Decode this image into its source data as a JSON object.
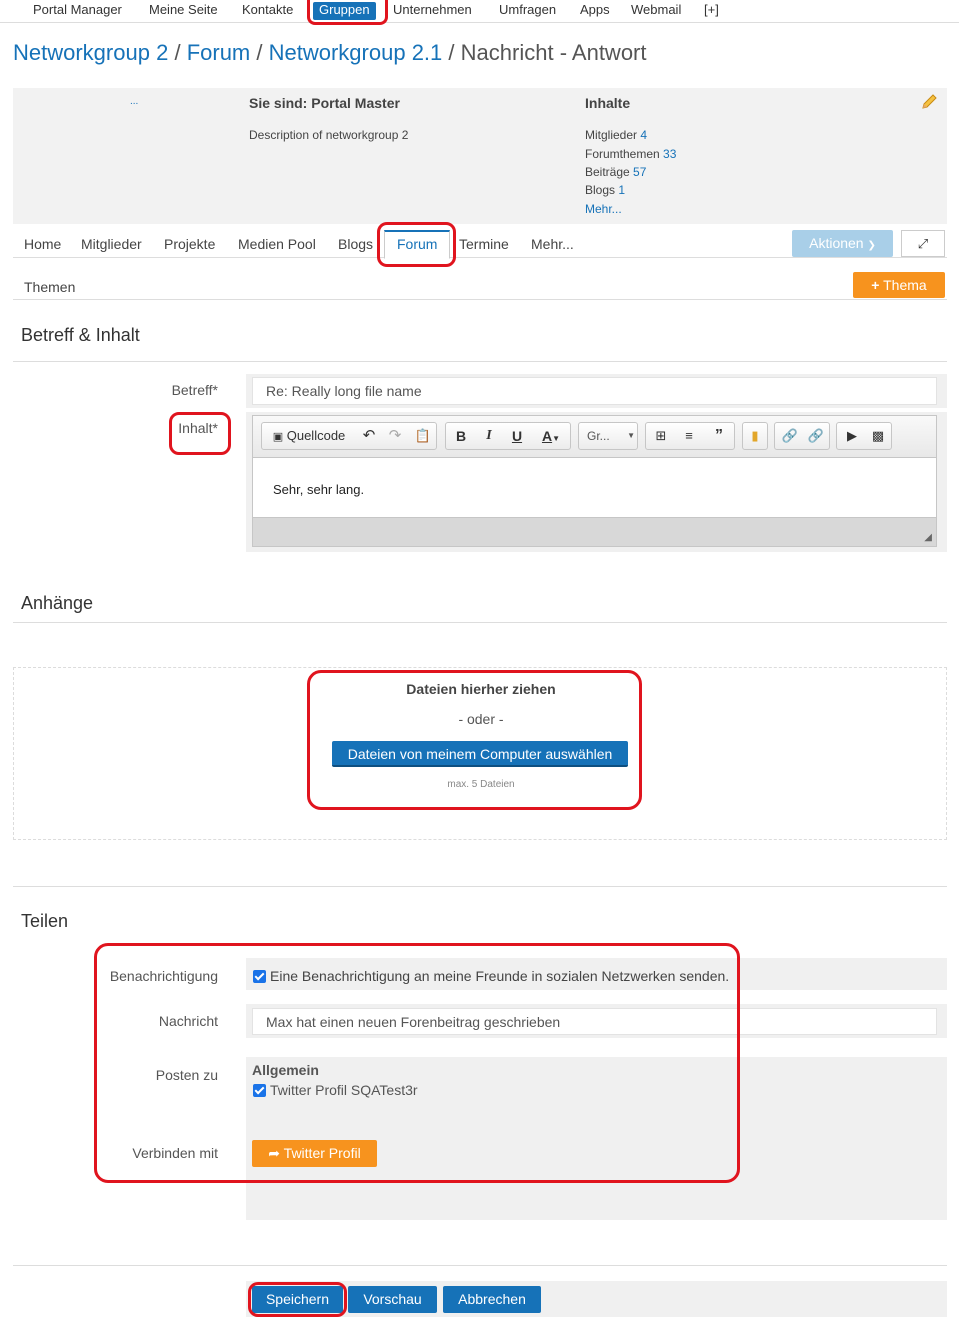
{
  "topnav": {
    "items": [
      "Portal Manager",
      "Meine Seite",
      "Kontakte",
      "Gruppen",
      "Unternehmen",
      "Umfragen",
      "Apps",
      "Webmail",
      "[+]"
    ],
    "active": "Gruppen"
  },
  "breadcrumb": {
    "group": "Networkgroup 2",
    "forum": "Forum",
    "subgroup": "Networkgroup 2.1",
    "current": "Nachricht - Antwort",
    "separator": "/"
  },
  "info": {
    "dots": "...",
    "role": "Sie sind: Portal Master",
    "description": "Description of networkgroup 2",
    "contents_title": "Inhalte",
    "stats": [
      {
        "label": "Mitglieder",
        "value": "4"
      },
      {
        "label": "Forumthemen",
        "value": "33"
      },
      {
        "label": "Beiträge",
        "value": "57"
      },
      {
        "label": "Blogs",
        "value": "1"
      }
    ],
    "more": "Mehr..."
  },
  "tabs": [
    "Home",
    "Mitglieder",
    "Projekte",
    "Medien Pool",
    "Blogs",
    "Forum",
    "Termine",
    "Mehr..."
  ],
  "actions_button": "Aktionen",
  "subnav": {
    "themes": "Themen",
    "new_thema": "Thema"
  },
  "form": {
    "section_title": "Betreff & Inhalt",
    "subject_label": "Betreff*",
    "subject_value": "Re: Really long file name",
    "content_label": "Inhalt*",
    "toolbar": {
      "source": "Quellcode",
      "bold": "B",
      "italic": "I",
      "underline": "U",
      "font_color": "A",
      "size": "Gr..."
    },
    "content_text": "Sehr, sehr lang."
  },
  "attachments": {
    "section_title": "Anhänge",
    "drop_title": "Dateien hierher ziehen",
    "or": "- oder -",
    "choose_button": "Dateien von meinem Computer auswählen",
    "max": "max. 5 Dateien"
  },
  "share": {
    "section_title": "Teilen",
    "notification_label": "Benachrichtigung",
    "notification_text": "Eine Benachrichtigung an meine Freunde in sozialen Netzwerken senden.",
    "message_label": "Nachricht",
    "message_value": "Max hat einen neuen Forenbeitrag geschrieben",
    "post_to_label": "Posten zu",
    "post_to_group": "Allgemein",
    "post_to_profile": "Twitter Profil SQATest3r",
    "connect_label": "Verbinden mit",
    "connect_button": "Twitter Profil"
  },
  "footer": {
    "save": "Speichern",
    "preview": "Vorschau",
    "cancel": "Abbrechen"
  },
  "colors": {
    "link": "#1672b8",
    "orange": "#f7931e",
    "highlight": "#e0141e"
  }
}
